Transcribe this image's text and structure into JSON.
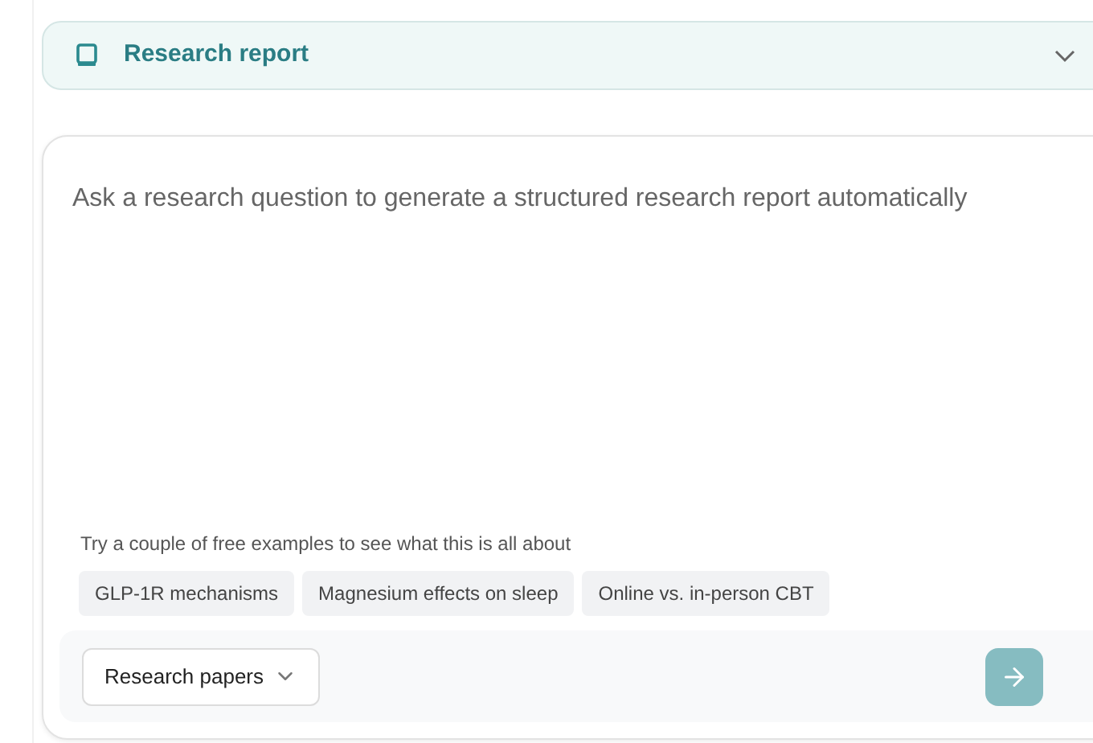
{
  "header": {
    "title": "Research report",
    "expanded": false
  },
  "composer": {
    "placeholder": "Ask a research question to generate a structured research report automatically",
    "examples_label": "Try a couple of free examples to see what this is all about",
    "examples": [
      "GLP-1R mechanisms",
      "Magnesium effects on sleep",
      "Online vs. in-person CBT"
    ],
    "source_select": "Research papers",
    "send_button": {
      "disabled": true
    }
  }
}
